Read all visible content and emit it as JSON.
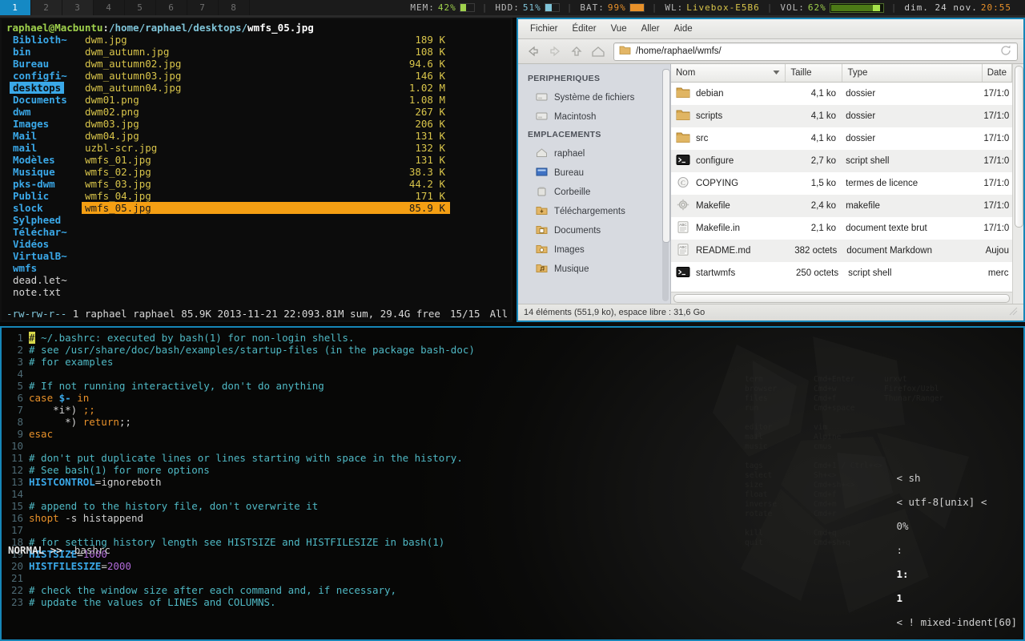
{
  "topbar": {
    "tags": [
      {
        "label": "1",
        "state": "selected"
      },
      {
        "label": "2",
        "state": "occupied"
      },
      {
        "label": "3",
        "state": "occupied"
      },
      {
        "label": "4",
        "state": "empty"
      },
      {
        "label": "5",
        "state": "empty"
      },
      {
        "label": "6",
        "state": "empty"
      },
      {
        "label": "7",
        "state": "empty"
      },
      {
        "label": "8",
        "state": "empty"
      }
    ],
    "status": {
      "mem_label": "MEM:",
      "mem_value": "42%",
      "hdd_label": "HDD:",
      "hdd_value": "51%",
      "bat_label": "BAT:",
      "bat_value": "99%",
      "wl_label": "WL:",
      "wl_value": "Livebox-E5B6",
      "vol_label": "VOL:",
      "vol_value": "62%",
      "date": "dim. 24 nov.",
      "time": "20:55",
      "separator": "|",
      "colors": {
        "mem": "#9fd14c",
        "hdd": "#7fc4d8",
        "bat": "#e8912a",
        "wl": "#d8c44a",
        "vol": "#9fd14c",
        "time": "#e8912a",
        "accent": "#1589c4"
      }
    }
  },
  "ranger": {
    "path": {
      "user_host": "raphael@Macbuntu",
      "colon": ":",
      "dir": "/home/raphael/desktops/",
      "file": "wmfs_05.jpg"
    },
    "dirs": [
      "Biblioth~",
      "bin",
      "Bureau",
      "configfi~",
      "desktops",
      "Documents",
      "dwm",
      "Images",
      "Mail",
      "mail",
      "Modèles",
      "Musique",
      "pks-dwm",
      "Public",
      "slock",
      "Sylpheed",
      "Téléchar~",
      "Vidéos",
      "VirtualB~",
      "wmfs",
      "dead.let~",
      "note.txt"
    ],
    "selected_dir": "desktops",
    "plain_dirs": [
      "dead.let~",
      "note.txt"
    ],
    "files": [
      {
        "name": "dwm.jpg",
        "size": "189 K"
      },
      {
        "name": "dwm_autumn.jpg",
        "size": "108 K"
      },
      {
        "name": "dwm_autumn02.jpg",
        "size": "94.6 K"
      },
      {
        "name": "dwm_autumn03.jpg",
        "size": "146 K"
      },
      {
        "name": "dwm_autumn04.jpg",
        "size": "1.02 M"
      },
      {
        "name": "dwm01.png",
        "size": "1.08 M"
      },
      {
        "name": "dwm02.png",
        "size": "267 K"
      },
      {
        "name": "dwm03.jpg",
        "size": "206 K"
      },
      {
        "name": "dwm04.jpg",
        "size": "131 K"
      },
      {
        "name": "uzbl-scr.jpg",
        "size": "132 K"
      },
      {
        "name": "wmfs_01.jpg",
        "size": "131 K"
      },
      {
        "name": "wmfs_02.jpg",
        "size": "38.3 K"
      },
      {
        "name": "wmfs_03.jpg",
        "size": "44.2 K"
      },
      {
        "name": "wmfs_04.jpg",
        "size": "171 K"
      },
      {
        "name": "wmfs_05.jpg",
        "size": "85.9 K"
      }
    ],
    "selected_file": "wmfs_05.jpg",
    "statusline": {
      "permissions": "-rw-rw-r--",
      "links": "1",
      "owner": "raphael",
      "group": "raphael",
      "size": "85.9K",
      "date": "2013-11-21",
      "time": "22:09",
      "sum": "3.81M sum, 29.4G free",
      "position": "15/15",
      "scroll": "All"
    }
  },
  "thunar": {
    "menu": [
      "Fichier",
      "Éditer",
      "Vue",
      "Aller",
      "Aide"
    ],
    "toolbar_icons": [
      "back-arrow-icon",
      "forward-arrow-icon",
      "up-arrow-icon",
      "home-icon"
    ],
    "path_value": "/home/raphael/wmfs/",
    "reload_icon": "reload-icon",
    "sidebar": {
      "group1_title": "PERIPHERIQUES",
      "group1_items": [
        {
          "label": "Système de fichiers",
          "icon": "drive-icon"
        },
        {
          "label": "Macintosh",
          "icon": "drive-icon"
        }
      ],
      "group2_title": "EMPLACEMENTS",
      "group2_items": [
        {
          "label": "raphael",
          "icon": "home-folder-icon"
        },
        {
          "label": "Bureau",
          "icon": "desktop-folder-icon"
        },
        {
          "label": "Corbeille",
          "icon": "trash-icon"
        },
        {
          "label": "Téléchargements",
          "icon": "downloads-folder-icon"
        },
        {
          "label": "Documents",
          "icon": "documents-folder-icon"
        },
        {
          "label": "Images",
          "icon": "pictures-folder-icon"
        },
        {
          "label": "Musique",
          "icon": "music-folder-icon"
        }
      ]
    },
    "columns": [
      "Nom",
      "Taille",
      "Type",
      "Date"
    ],
    "sort_column": "Nom",
    "rows": [
      {
        "name": "debian",
        "size": "4,1 ko",
        "type": "dossier",
        "date": "17/1&#58;0",
        "icon": "folder-icon"
      },
      {
        "name": "scripts",
        "size": "4,1 ko",
        "type": "dossier",
        "date": "17/1&#58;0",
        "icon": "folder-icon"
      },
      {
        "name": "src",
        "size": "4,1 ko",
        "type": "dossier",
        "date": "17/1&#58;0",
        "icon": "folder-icon"
      },
      {
        "name": "configure",
        "size": "2,7 ko",
        "type": "script shell",
        "date": "17/1&#58;0",
        "icon": "terminal-script-icon"
      },
      {
        "name": "COPYING",
        "size": "1,5 ko",
        "type": "termes de licence",
        "date": "17/1&#58;0",
        "icon": "copyright-icon"
      },
      {
        "name": "Makefile",
        "size": "2,4 ko",
        "type": "makefile",
        "date": "17/1&#58;0",
        "icon": "gear-icon"
      },
      {
        "name": "Makefile.in",
        "size": "2,1 ko",
        "type": "document texte brut",
        "date": "17/1&#58;0",
        "icon": "text-file-icon"
      },
      {
        "name": "README.md",
        "size": "382 octets",
        "type": "document Markdown",
        "date": "Aujou",
        "icon": "text-file-icon"
      },
      {
        "name": "startwmfs",
        "size": "250 octets",
        "type": "script shell",
        "date": "merc",
        "icon": "terminal-script-icon"
      }
    ],
    "status": "14 éléments (551,9 ko), espace libre : 31,6 Go"
  },
  "vim": {
    "lines": [
      {
        "n": "1",
        "segs": [
          {
            "t": "#",
            "c": "cursor"
          },
          {
            "t": " ~/.bashrc: executed by bash(1) for non-login shells.",
            "c": "c-comment"
          }
        ]
      },
      {
        "n": "2",
        "segs": [
          {
            "t": "# see /usr/share/doc/bash/examples/startup-files (in the package bash-doc)",
            "c": "c-comment"
          }
        ]
      },
      {
        "n": "3",
        "segs": [
          {
            "t": "# for examples",
            "c": "c-comment"
          }
        ]
      },
      {
        "n": "4",
        "segs": []
      },
      {
        "n": "5",
        "segs": [
          {
            "t": "# If not running interactively, don't do anything",
            "c": "c-comment"
          }
        ]
      },
      {
        "n": "6",
        "segs": [
          {
            "t": "case ",
            "c": "c-kw"
          },
          {
            "t": "$-",
            "c": "c-var"
          },
          {
            "t": " ",
            "c": "c-plain"
          },
          {
            "t": "in",
            "c": "c-kw"
          }
        ]
      },
      {
        "n": "7",
        "segs": [
          {
            "t": "    *i*) ",
            "c": "c-plain"
          },
          {
            "t": ";;",
            "c": "c-kw"
          }
        ]
      },
      {
        "n": "8",
        "segs": [
          {
            "t": "      *) ",
            "c": "c-plain"
          },
          {
            "t": "return",
            "c": "c-kw"
          },
          {
            "t": ";;",
            "c": "c-plain"
          }
        ]
      },
      {
        "n": "9",
        "segs": [
          {
            "t": "esac",
            "c": "c-kw"
          }
        ]
      },
      {
        "n": "10",
        "segs": []
      },
      {
        "n": "11",
        "segs": [
          {
            "t": "# don't put duplicate lines or lines starting with space in the history.",
            "c": "c-comment"
          }
        ]
      },
      {
        "n": "12",
        "segs": [
          {
            "t": "# See bash(1) for more options",
            "c": "c-comment"
          }
        ]
      },
      {
        "n": "13",
        "segs": [
          {
            "t": "HISTCONTROL",
            "c": "c-var"
          },
          {
            "t": "=ignoreboth",
            "c": "c-plain"
          }
        ]
      },
      {
        "n": "14",
        "segs": []
      },
      {
        "n": "15",
        "segs": [
          {
            "t": "# append to the history file, don't overwrite it",
            "c": "c-comment"
          }
        ]
      },
      {
        "n": "16",
        "segs": [
          {
            "t": "shopt",
            "c": "c-kw"
          },
          {
            "t": " -s histappend",
            "c": "c-plain"
          }
        ]
      },
      {
        "n": "17",
        "segs": []
      },
      {
        "n": "18",
        "segs": [
          {
            "t": "# for setting history length see HISTSIZE and HISTFILESIZE in bash(1)",
            "c": "c-comment"
          }
        ]
      },
      {
        "n": "19",
        "segs": [
          {
            "t": "HISTSIZE",
            "c": "c-var"
          },
          {
            "t": "=",
            "c": "c-plain"
          },
          {
            "t": "1000",
            "c": "c-num"
          }
        ]
      },
      {
        "n": "20",
        "segs": [
          {
            "t": "HISTFILESIZE",
            "c": "c-var"
          },
          {
            "t": "=",
            "c": "c-plain"
          },
          {
            "t": "2000",
            "c": "c-num"
          }
        ]
      },
      {
        "n": "21",
        "segs": []
      },
      {
        "n": "22",
        "segs": [
          {
            "t": "# check the window size after each command and, if necessary,",
            "c": "c-comment"
          }
        ]
      },
      {
        "n": "23",
        "segs": [
          {
            "t": "# update the values of LINES and COLUMNS.",
            "c": "c-comment"
          }
        ]
      }
    ],
    "status": {
      "mode": "NORMAL",
      "arrow": ">>",
      "filename": ".bashrc",
      "filetype": "< sh",
      "encoding": "< utf-8[unix] <",
      "percent": "0%",
      "colon": ":",
      "line": "1:",
      "col": "1",
      "warning": "< ! mixed-indent[60]"
    }
  },
  "cheatsheet": [
    [
      [
        "term",
        "Cmd+Enter",
        "urxvt"
      ],
      [
        "browser",
        "Cmd+w",
        "Firefox/Uzbl"
      ],
      [
        "files",
        "Cmd+f",
        "Thunar/Ranger"
      ],
      [
        "run",
        "Cmd+space",
        ""
      ]
    ],
    [
      [
        "editor",
        "vim",
        ""
      ],
      [
        "mail",
        "Alpine",
        ""
      ],
      [
        "music",
        "cmus",
        ""
      ]
    ],
    [
      [
        "tags",
        "Cmd+1 / Ctrl+<>",
        ""
      ],
      [
        "select",
        "Sh+<>",
        ""
      ],
      [
        "size",
        "Cmd+sh+<>",
        ""
      ],
      [
        "float",
        "Cmd+f",
        ""
      ],
      [
        "inverse",
        "Cmd+m",
        ""
      ],
      [
        "rotate",
        "Cmd+r",
        ""
      ]
    ],
    [
      [
        "kill",
        "Cmd+q",
        ""
      ],
      [
        "quit",
        "Cmd+sh+q",
        ""
      ]
    ]
  ]
}
